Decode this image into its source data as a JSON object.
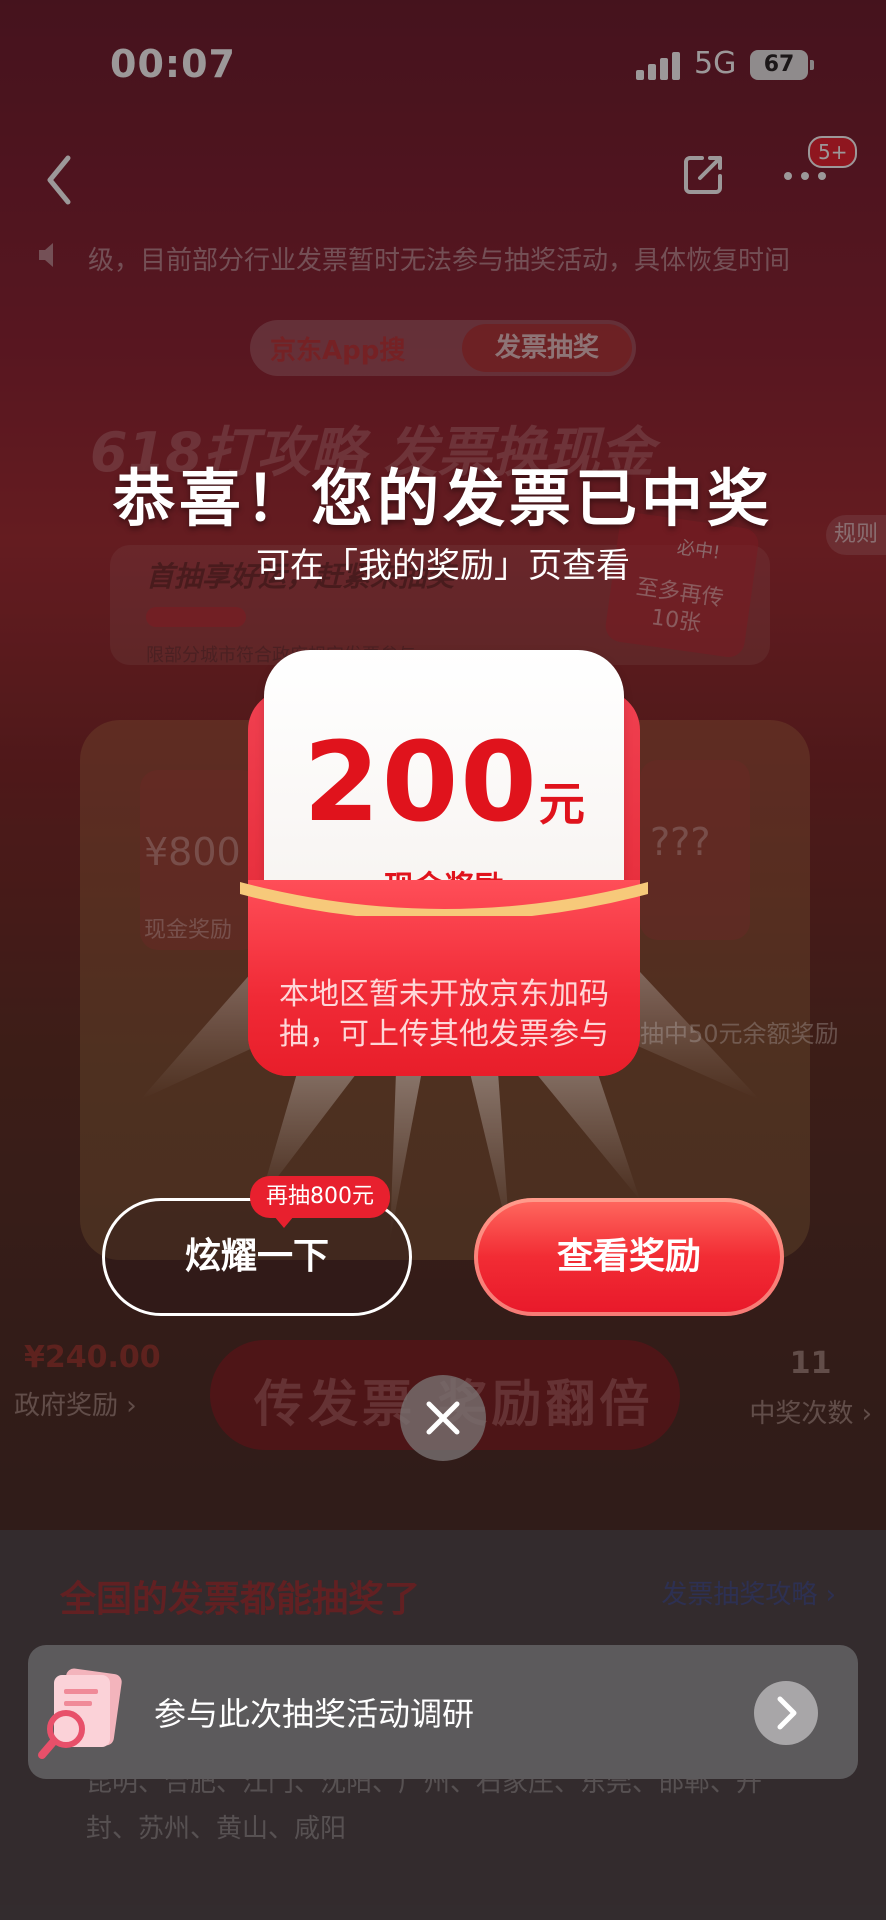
{
  "status_bar": {
    "time": "00:07",
    "network": "5G",
    "battery": "67"
  },
  "nav": {
    "badge": "5+"
  },
  "notice": {
    "text": "级，目前部分行业发票暂时无法参与抽奖活动，具体恢复时间"
  },
  "search": {
    "brand": "京东App搜",
    "tag": "发票抽奖"
  },
  "background": {
    "headline": "618打攻略 发票换现金",
    "rules": "规则",
    "card_line1": "首抽享好运，赶紧来抽奖",
    "card_line2": "限部分城市符合政府规定发票参与",
    "sticker_top": "必中!",
    "sticker_text": "至多再传10张",
    "left_slot_amount": "¥800",
    "left_slot_label": "现金奖励",
    "right_slot": "???",
    "right_note": "抽中50元余额奖励",
    "cta": "传发票 奖励翻倍",
    "gov_amount": "¥240.00",
    "gov_label": "政府奖励 ›",
    "wins_count": "11",
    "wins_label": "中奖次数 ›",
    "section_title": "全国的发票都能抽奖了",
    "section_link": "发票抽奖攻略 ›",
    "cities": "昆明、合肥、江门、沈阳、广州、石家庄、东莞、邯郸、开封、苏州、黄山、咸阳"
  },
  "modal": {
    "title": "恭喜！您的发票已中奖",
    "subtitle": "可在「我的奖励」页查看",
    "amount": "200",
    "unit": "元",
    "reward_label": "现金奖励",
    "note": "本地区暂未开放京东加码抽，可上传其他发票参与",
    "bubble": "再抽800元",
    "btn_show_off": "炫耀一下",
    "btn_view_reward": "查看奖励"
  },
  "survey": {
    "text": "参与此次抽奖活动调研"
  },
  "colors": {
    "accent_red": "#e0131c",
    "button_red": "#f22c34"
  }
}
